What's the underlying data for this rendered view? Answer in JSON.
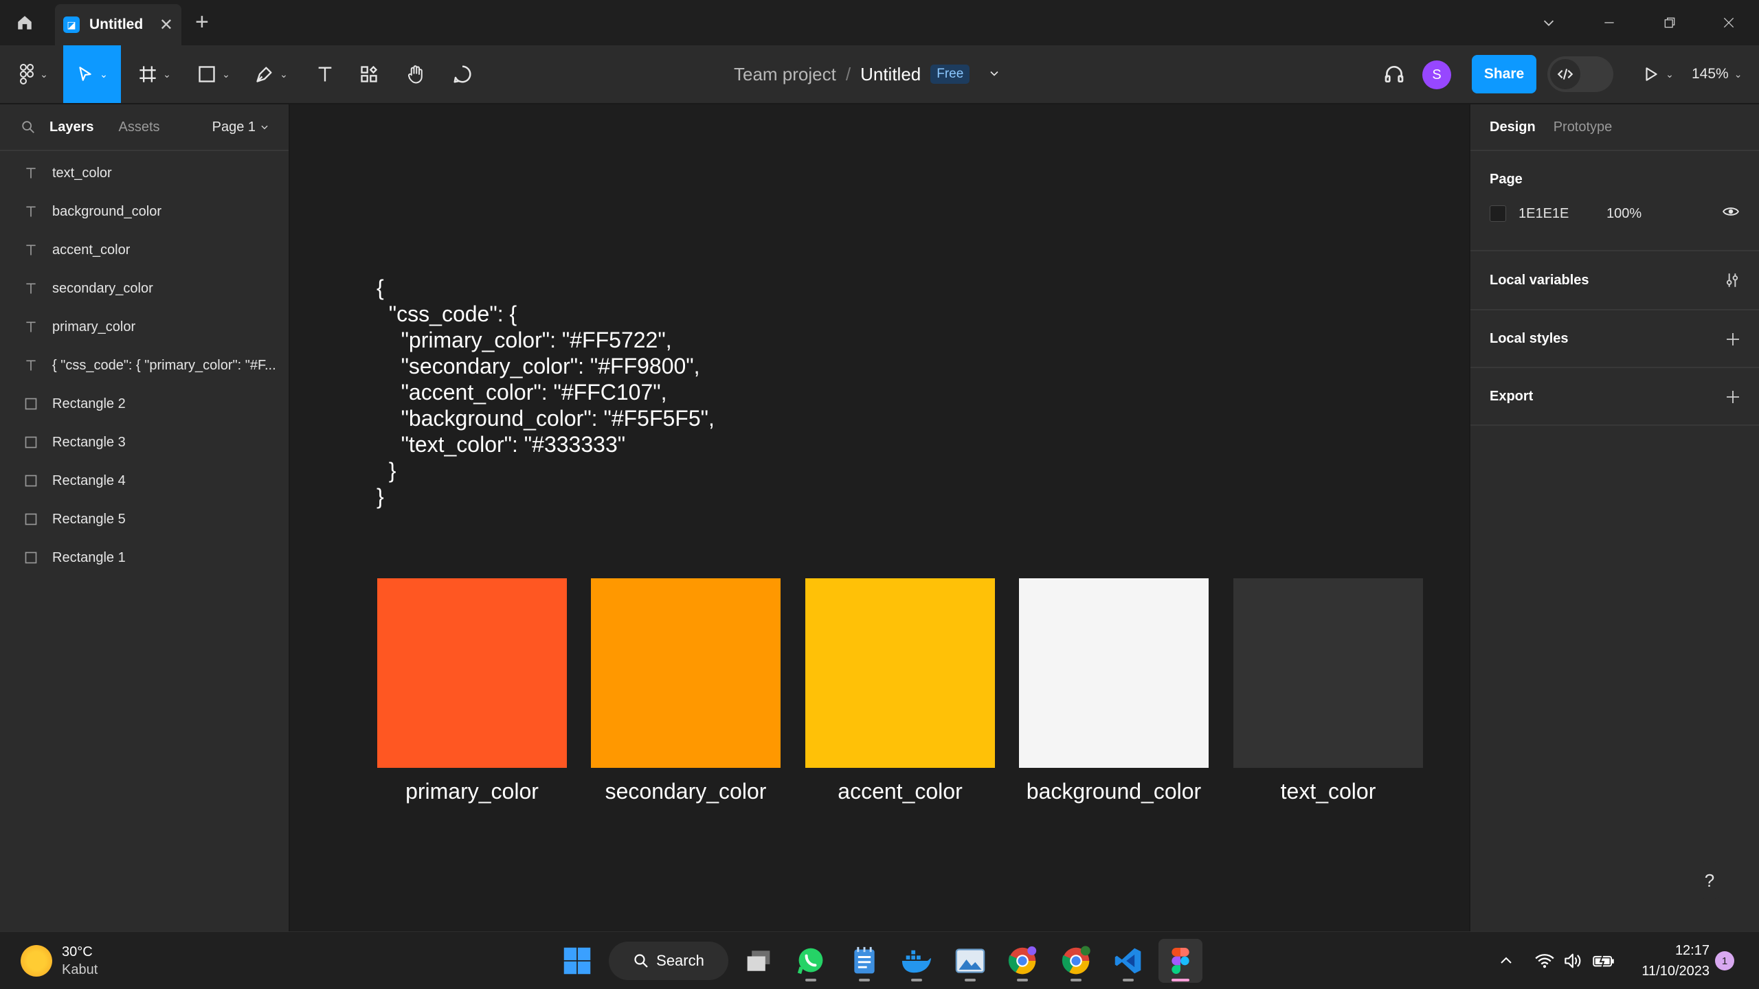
{
  "titlebar": {
    "tab_title": "Untitled",
    "tab_close": "✕",
    "new_tab": "+"
  },
  "toolbar": {
    "breadcrumb_team": "Team project",
    "breadcrumb_sep": "/",
    "file_name": "Untitled",
    "plan_badge": "Free",
    "avatar_letter": "S",
    "share_label": "Share",
    "zoom_level": "145%"
  },
  "left_panel": {
    "tab_layers": "Layers",
    "tab_assets": "Assets",
    "page_label": "Page 1",
    "layers": [
      {
        "type": "text",
        "label": "text_color"
      },
      {
        "type": "text",
        "label": "background_color"
      },
      {
        "type": "text",
        "label": "accent_color"
      },
      {
        "type": "text",
        "label": "secondary_color"
      },
      {
        "type": "text",
        "label": "primary_color"
      },
      {
        "type": "text",
        "label": "{ \"css_code\": { \"primary_color\": \"#F..."
      },
      {
        "type": "rect",
        "label": "Rectangle 2"
      },
      {
        "type": "rect",
        "label": "Rectangle 3"
      },
      {
        "type": "rect",
        "label": "Rectangle 4"
      },
      {
        "type": "rect",
        "label": "Rectangle 5"
      },
      {
        "type": "rect",
        "label": "Rectangle 1"
      }
    ]
  },
  "canvas": {
    "code_lines": [
      "{",
      "  \"css_code\": {",
      "    \"primary_color\": \"#FF5722\",",
      "    \"secondary_color\": \"#FF9800\",",
      "    \"accent_color\": \"#FFC107\",",
      "    \"background_color\": \"#F5F5F5\",",
      "    \"text_color\": \"#333333\"",
      "  }",
      "}"
    ],
    "swatches": [
      {
        "label": "primary_color",
        "color": "#FF5722"
      },
      {
        "label": "secondary_color",
        "color": "#FF9800"
      },
      {
        "label": "accent_color",
        "color": "#FFC107"
      },
      {
        "label": "background_color",
        "color": "#F5F5F5"
      },
      {
        "label": "text_color",
        "color": "#333333"
      }
    ],
    "help_label": "?"
  },
  "right_panel": {
    "tab_design": "Design",
    "tab_prototype": "Prototype",
    "page_heading": "Page",
    "page_color_hex": "1E1E1E",
    "page_opacity": "100%",
    "local_variables": "Local variables",
    "local_styles": "Local styles",
    "export": "Export"
  },
  "taskbar": {
    "weather_temp": "30°C",
    "weather_condition": "Kabut",
    "search_label": "Search",
    "time": "12:17",
    "date": "11/10/2023",
    "notification_count": "1"
  },
  "colors": {
    "accent": "#0d99ff",
    "panel_bg": "#2c2c2c",
    "canvas_bg": "#1e1e1e",
    "avatar": "#9747ff"
  }
}
